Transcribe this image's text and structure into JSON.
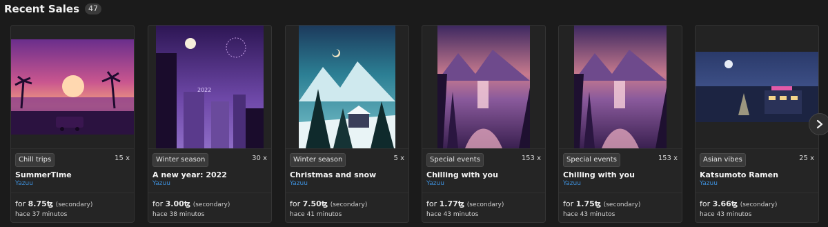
{
  "header": {
    "title": "Recent Sales",
    "count": "47"
  },
  "cards": [
    {
      "collection": "Chill trips",
      "quantity": "15 x",
      "name": "SummerTime",
      "author": "Yazuu",
      "price_prefix": "for",
      "price": "8.75ꜩ",
      "price_note": "(secondary)",
      "time": "hace 37 minutos"
    },
    {
      "collection": "Winter season",
      "quantity": "30 x",
      "name": "A new year: 2022",
      "author": "Yazuu",
      "price_prefix": "for",
      "price": "3.00ꜩ",
      "price_note": "(secondary)",
      "time": "hace 38 minutos",
      "artwork_text": "2022"
    },
    {
      "collection": "Winter season",
      "quantity": "5 x",
      "name": "Christmas and snow",
      "author": "Yazuu",
      "price_prefix": "for",
      "price": "7.50ꜩ",
      "price_note": "(secondary)",
      "time": "hace 41 minutos"
    },
    {
      "collection": "Special events",
      "quantity": "153 x",
      "name": "Chilling with you",
      "author": "Yazuu",
      "price_prefix": "for",
      "price": "1.77ꜩ",
      "price_note": "(secondary)",
      "time": "hace 43 minutos"
    },
    {
      "collection": "Special events",
      "quantity": "153 x",
      "name": "Chilling with you",
      "author": "Yazuu",
      "price_prefix": "for",
      "price": "1.75ꜩ",
      "price_note": "(secondary)",
      "time": "hace 43 minutos"
    },
    {
      "collection": "Asian vibes",
      "quantity": "25 x",
      "name": "Katsumoto Ramen",
      "author": "Yazuu",
      "price_prefix": "for",
      "price": "3.66ꜩ",
      "price_note": "(secondary)",
      "time": "hace 43 minutos"
    }
  ],
  "icons": {
    "next": "chevron-right-icon"
  },
  "colors": {
    "background": "#1b1b1b",
    "card": "#252525",
    "author_link": "#3d8ed8"
  }
}
